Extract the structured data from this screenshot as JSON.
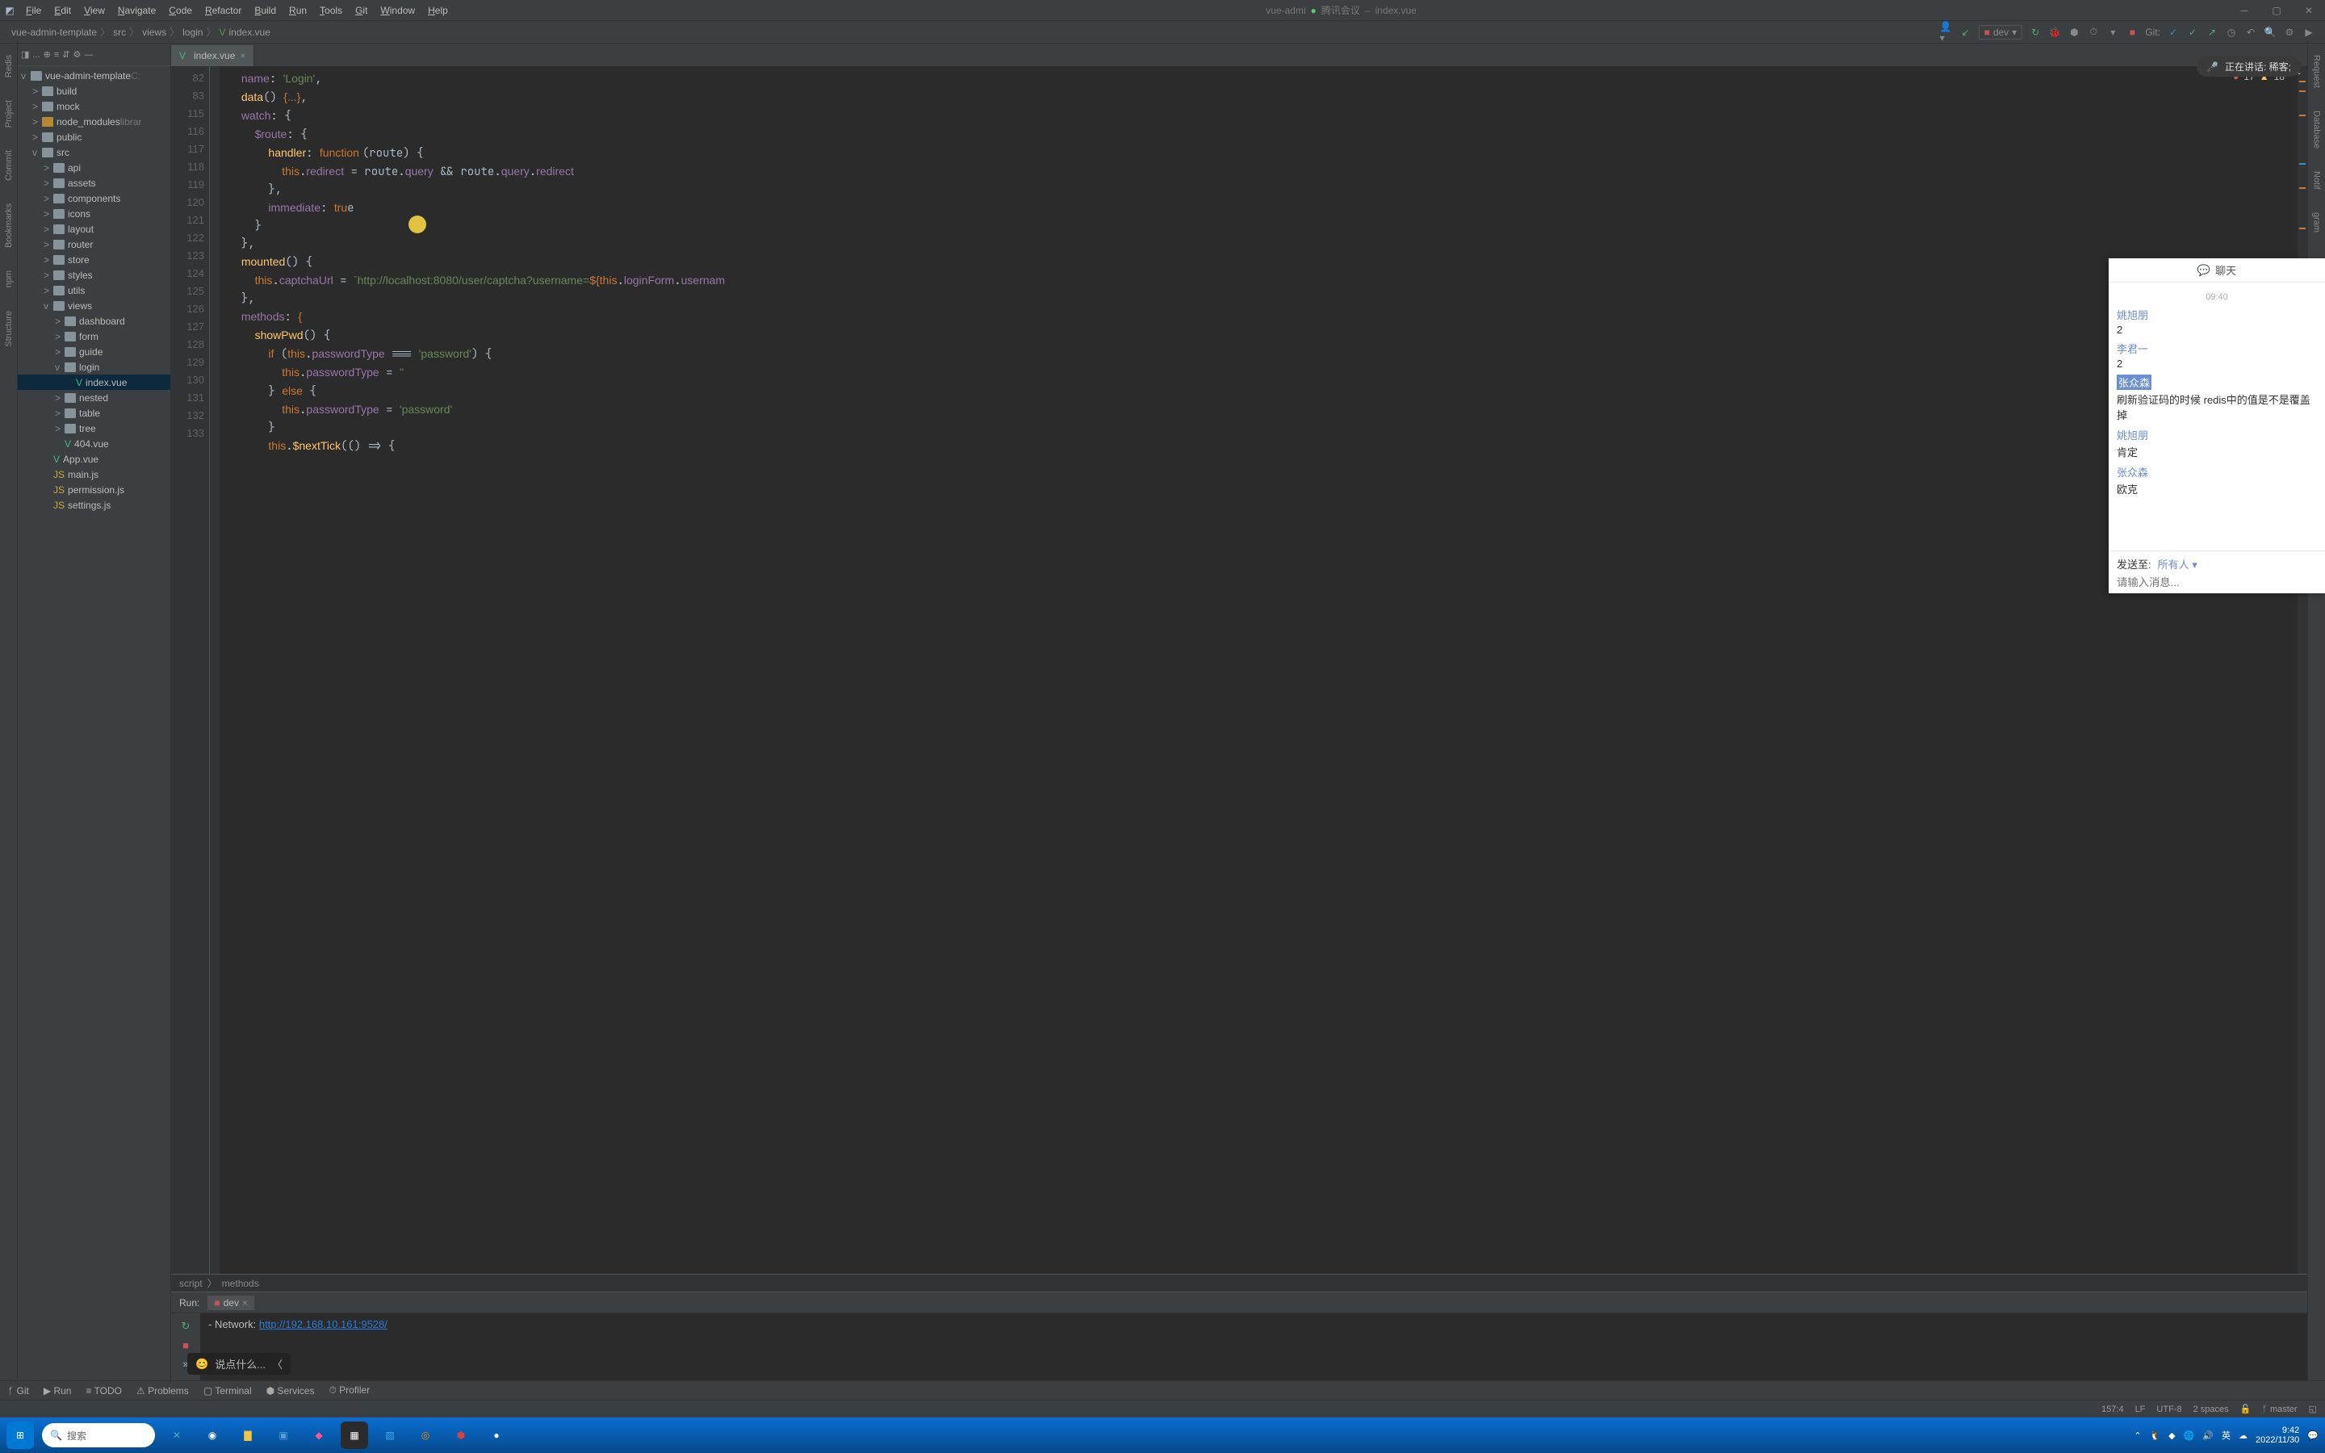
{
  "menu": [
    "File",
    "Edit",
    "View",
    "Navigate",
    "Code",
    "Refactor",
    "Build",
    "Run",
    "Tools",
    "Git",
    "Window",
    "Help"
  ],
  "title_tabs": [
    "vue-admi",
    "腾讯会议",
    "index.vue"
  ],
  "crumbs": [
    "vue-admin-template",
    "src",
    "views",
    "login",
    "index.vue"
  ],
  "run_config": "dev",
  "git_label": "Git:",
  "speak": {
    "label": "正在讲话: 稀客;"
  },
  "left_strips": [
    "Redis",
    "Project",
    "Commit",
    "Bookmarks",
    "npm",
    "Structure"
  ],
  "right_strips": [
    "Request",
    "Database",
    "Notif",
    "gram"
  ],
  "project_root": "vue-admin-template",
  "project_root_suffix": "C:",
  "tree": [
    {
      "d": 1,
      "a": ">",
      "t": "folder",
      "n": "build"
    },
    {
      "d": 1,
      "a": ">",
      "t": "folder",
      "n": "mock"
    },
    {
      "d": 1,
      "a": ">",
      "t": "lib",
      "n": "node_modules",
      "s": "librar"
    },
    {
      "d": 1,
      "a": ">",
      "t": "folder",
      "n": "public"
    },
    {
      "d": 1,
      "a": "v",
      "t": "folder",
      "n": "src"
    },
    {
      "d": 2,
      "a": ">",
      "t": "folder",
      "n": "api"
    },
    {
      "d": 2,
      "a": ">",
      "t": "folder",
      "n": "assets"
    },
    {
      "d": 2,
      "a": ">",
      "t": "folder",
      "n": "components"
    },
    {
      "d": 2,
      "a": ">",
      "t": "folder",
      "n": "icons"
    },
    {
      "d": 2,
      "a": ">",
      "t": "folder",
      "n": "layout"
    },
    {
      "d": 2,
      "a": ">",
      "t": "folder",
      "n": "router"
    },
    {
      "d": 2,
      "a": ">",
      "t": "folder",
      "n": "store"
    },
    {
      "d": 2,
      "a": ">",
      "t": "folder",
      "n": "styles"
    },
    {
      "d": 2,
      "a": ">",
      "t": "folder",
      "n": "utils"
    },
    {
      "d": 2,
      "a": "v",
      "t": "folder",
      "n": "views"
    },
    {
      "d": 3,
      "a": ">",
      "t": "folder",
      "n": "dashboard"
    },
    {
      "d": 3,
      "a": ">",
      "t": "folder",
      "n": "form"
    },
    {
      "d": 3,
      "a": ">",
      "t": "folder",
      "n": "guide"
    },
    {
      "d": 3,
      "a": "v",
      "t": "folder",
      "n": "login"
    },
    {
      "d": 4,
      "a": " ",
      "t": "vue",
      "n": "index.vue",
      "sel": true
    },
    {
      "d": 3,
      "a": ">",
      "t": "folder",
      "n": "nested"
    },
    {
      "d": 3,
      "a": ">",
      "t": "folder",
      "n": "table"
    },
    {
      "d": 3,
      "a": ">",
      "t": "folder",
      "n": "tree"
    },
    {
      "d": 3,
      "a": " ",
      "t": "vue",
      "n": "404.vue"
    },
    {
      "d": 2,
      "a": " ",
      "t": "vue",
      "n": "App.vue"
    },
    {
      "d": 2,
      "a": " ",
      "t": "js",
      "n": "main.js"
    },
    {
      "d": 2,
      "a": " ",
      "t": "js",
      "n": "permission.js"
    },
    {
      "d": 2,
      "a": " ",
      "t": "js",
      "n": "settings.js"
    }
  ],
  "tab": {
    "name": "index.vue"
  },
  "problems": {
    "errors": "17",
    "warnings": "18"
  },
  "gutter": [
    "82",
    "83",
    "115",
    "116",
    "117",
    "118",
    "119",
    "120",
    "121",
    "122",
    "123",
    "124",
    "125",
    "126",
    "127",
    "128",
    "129",
    "130",
    "131",
    "132",
    "133"
  ],
  "editor_breadcrumb": [
    "script",
    "methods"
  ],
  "run": {
    "title": "Run:",
    "config": "dev",
    "network": "- Network:  ",
    "url": "http://192.168.10.161:9528/",
    "say": "说点什么..."
  },
  "tools": [
    "Git",
    "Run",
    "TODO",
    "Problems",
    "Terminal",
    "Services",
    "Profiler"
  ],
  "status": {
    "pos": "157:4",
    "sep": "LF",
    "enc": "UTF-8",
    "indent": "2 spaces",
    "branch": "master"
  },
  "chat": {
    "title": "聊天",
    "time": "09:40",
    "msgs": [
      {
        "u": "姚旭朋",
        "m": "2"
      },
      {
        "u": "李君一",
        "m": "2"
      },
      {
        "u": "张众森",
        "m": "刷新验证码的时候 redis中的值是不是覆盖掉",
        "sel": true
      },
      {
        "u": "姚旭朋",
        "m": "肯定"
      },
      {
        "u": "张众森",
        "m": "欧克"
      }
    ],
    "to_label": "发送至:",
    "to": "所有人",
    "placeholder": "请输入消息..."
  },
  "taskbar": {
    "search": "搜索",
    "ime": "英",
    "time": "9:42",
    "date": "2022/11/30"
  }
}
